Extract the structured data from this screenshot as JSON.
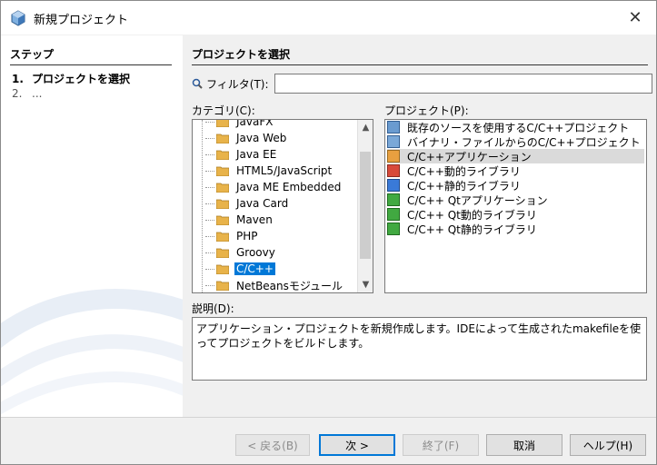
{
  "window": {
    "title": "新規プロジェクト",
    "close_glyph": "✕"
  },
  "sidebar": {
    "header": "ステップ",
    "steps": [
      {
        "num": "1.",
        "label": "プロジェクトを選択"
      },
      {
        "num": "2.",
        "label": "..."
      }
    ]
  },
  "main": {
    "section_title": "プロジェクトを選択",
    "filter": {
      "label": "フィルタ(T):",
      "value": ""
    },
    "categories": {
      "label": "カテゴリ(C):",
      "items": [
        "JavaFX",
        "Java Web",
        "Java EE",
        "HTML5/JavaScript",
        "Java ME Embedded",
        "Java Card",
        "Maven",
        "PHP",
        "Groovy",
        "C/C++",
        "NetBeansモジュール"
      ],
      "selected": "C/C++"
    },
    "projects": {
      "label": "プロジェクト(P):",
      "items": [
        {
          "label": "既存のソースを使用するC/C++プロジェクト",
          "icon": "existing-source-icon"
        },
        {
          "label": "バイナリ・ファイルからのC/C++プロジェクト",
          "icon": "binary-file-icon"
        },
        {
          "label": "C/C++アプリケーション",
          "icon": "cpp-application-icon"
        },
        {
          "label": "C/C++動的ライブラリ",
          "icon": "dynamic-library-icon"
        },
        {
          "label": "C/C++静的ライブラリ",
          "icon": "static-library-icon"
        },
        {
          "label": "C/C++ Qtアプリケーション",
          "icon": "qt-application-icon"
        },
        {
          "label": "C/C++ Qt動的ライブラリ",
          "icon": "qt-dynamic-library-icon"
        },
        {
          "label": "C/C++ Qt静的ライブラリ",
          "icon": "qt-static-library-icon"
        }
      ],
      "selected": "C/C++アプリケーション"
    },
    "description": {
      "label": "説明(D):",
      "text": "アプリケーション・プロジェクトを新規作成します。IDEによって生成されたmakefileを使ってプロジェクトをビルドします。"
    }
  },
  "buttons": {
    "back": "< 戻る(B)",
    "next": "次 >",
    "finish": "終了(F)",
    "cancel": "取消",
    "help": "ヘルプ(H)"
  }
}
